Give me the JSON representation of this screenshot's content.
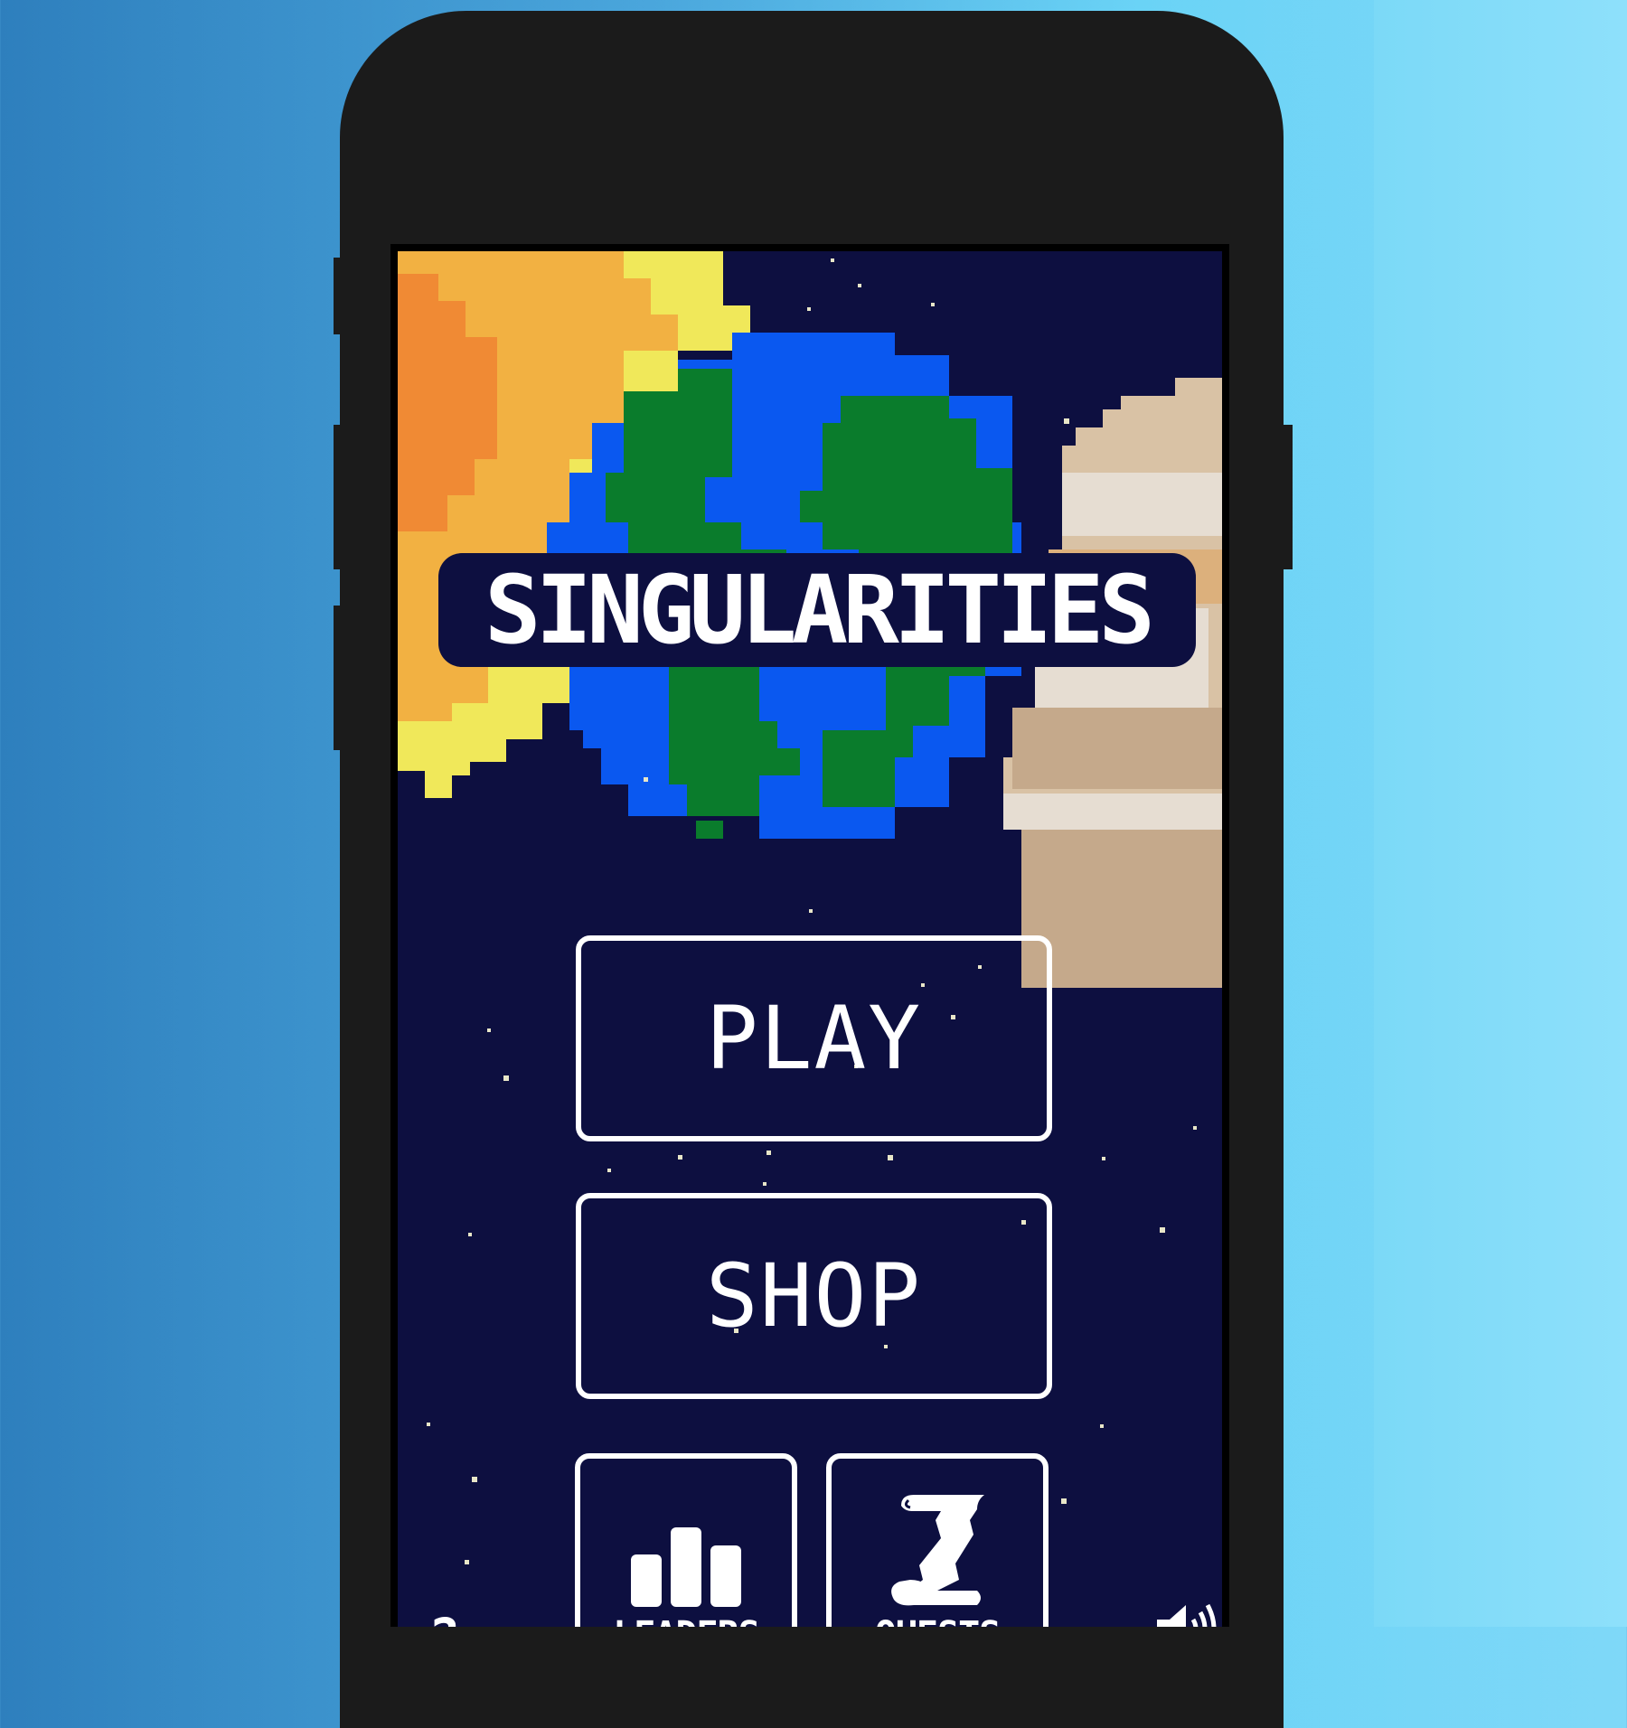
{
  "game": {
    "title": "SINGULARITIES",
    "menu": {
      "play_label": "PLAY",
      "shop_label": "SHOP",
      "leaders_label": "LEADERS",
      "quests_label": "QUESTS",
      "help_label": "?"
    },
    "icons": {
      "leaders": "bar-chart-icon",
      "quests": "scroll-icon",
      "sound": "speaker-icon"
    }
  },
  "colors": {
    "space": "#0d0f40",
    "ocean": "#0a58f0",
    "land": "#0a7c2c",
    "sun_outer": "#f0e85a",
    "sun_mid": "#f2b142",
    "sun_core": "#f08a34",
    "gas_giant_light": "#e6ddd2",
    "gas_giant_tan": "#c5a98b",
    "gas_giant_band": "#dcb07c",
    "phone_body": "#1b1b1b"
  }
}
